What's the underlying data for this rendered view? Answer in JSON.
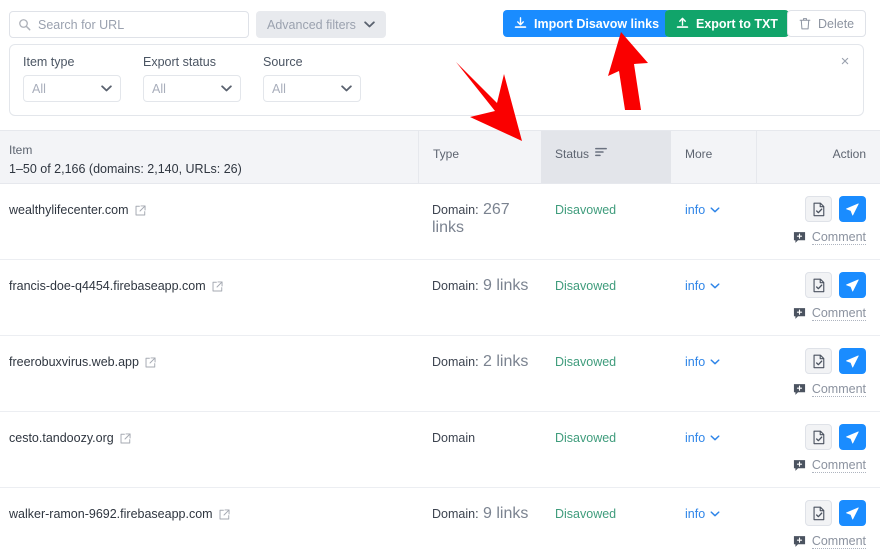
{
  "toolbar": {
    "search": {
      "placeholder": "Search for URL",
      "value": "",
      "icon": "search-icon"
    },
    "advanced_filters_label": "Advanced filters",
    "import_label": "Import Disavow links",
    "export_label": "Export to TXT",
    "delete_label": "Delete",
    "colors": {
      "import_bg": "#1a8cff",
      "export_bg": "#11a46a",
      "delete_fg": "#8d94a1"
    }
  },
  "filter_panel": {
    "close_label": "×",
    "filters": [
      {
        "label": "Item type",
        "value": "All"
      },
      {
        "label": "Export status",
        "value": "All"
      },
      {
        "label": "Source",
        "value": "All"
      }
    ]
  },
  "table": {
    "headers": {
      "item": "Item",
      "item_sub": "1–50 of 2,166 (domains: 2,140, URLs: 26)",
      "type": "Type",
      "status": "Status",
      "more": "More",
      "action": "Action"
    },
    "status_sorted": true,
    "rows": [
      {
        "item": "wealthylifecenter.com",
        "type_label": "Domain:",
        "type_count": "267 links",
        "status": "Disavowed",
        "more": "info",
        "comment": "Comment"
      },
      {
        "item": "francis-doe-q4454.firebaseapp.com",
        "type_label": "Domain:",
        "type_count": "9 links",
        "status": "Disavowed",
        "more": "info",
        "comment": "Comment"
      },
      {
        "item": "freerobuxvirus.web.app",
        "type_label": "Domain:",
        "type_count": "2 links",
        "status": "Disavowed",
        "more": "info",
        "comment": "Comment"
      },
      {
        "item": "cesto.tandoozy.org",
        "type_label": "Domain",
        "type_count": "",
        "status": "Disavowed",
        "more": "info",
        "comment": "Comment"
      },
      {
        "item": "walker-ramon-9692.firebaseapp.com",
        "type_label": "Domain:",
        "type_count": "9 links",
        "status": "Disavowed",
        "more": "info",
        "comment": "Comment"
      }
    ]
  },
  "annotations": {
    "arrow_color": "#fa0000",
    "arrows": [
      {
        "name": "arrow-pointing-to-type-column",
        "direction": "down-right"
      },
      {
        "name": "arrow-pointing-to-import-button",
        "direction": "up"
      }
    ]
  }
}
